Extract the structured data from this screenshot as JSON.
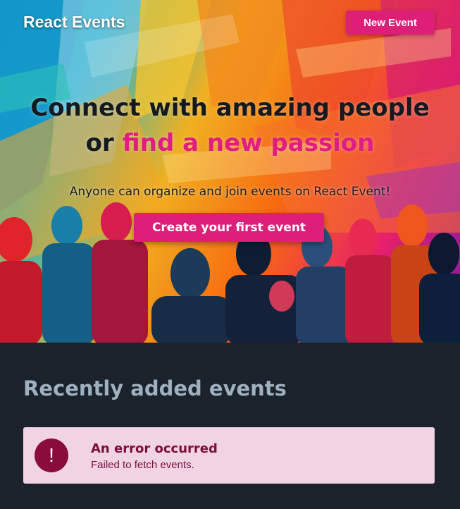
{
  "header": {
    "brand": "React Events",
    "new_event_label": "New Event"
  },
  "hero": {
    "headline_line1": "Connect with amazing people",
    "headline_line2_prefix": "or ",
    "headline_line2_accent": "find a new passion",
    "subline": "Anyone can organize and join events on React Event!",
    "cta_label": "Create your first event"
  },
  "events": {
    "section_title": "Recently added events",
    "error": {
      "icon": "!",
      "title": "An error occurred",
      "message": "Failed to fetch events."
    }
  },
  "colors": {
    "accent": "#de1f77",
    "page_background": "#1b222b",
    "error_background": "#f0d4e3",
    "error_text": "#7e0d3a"
  }
}
